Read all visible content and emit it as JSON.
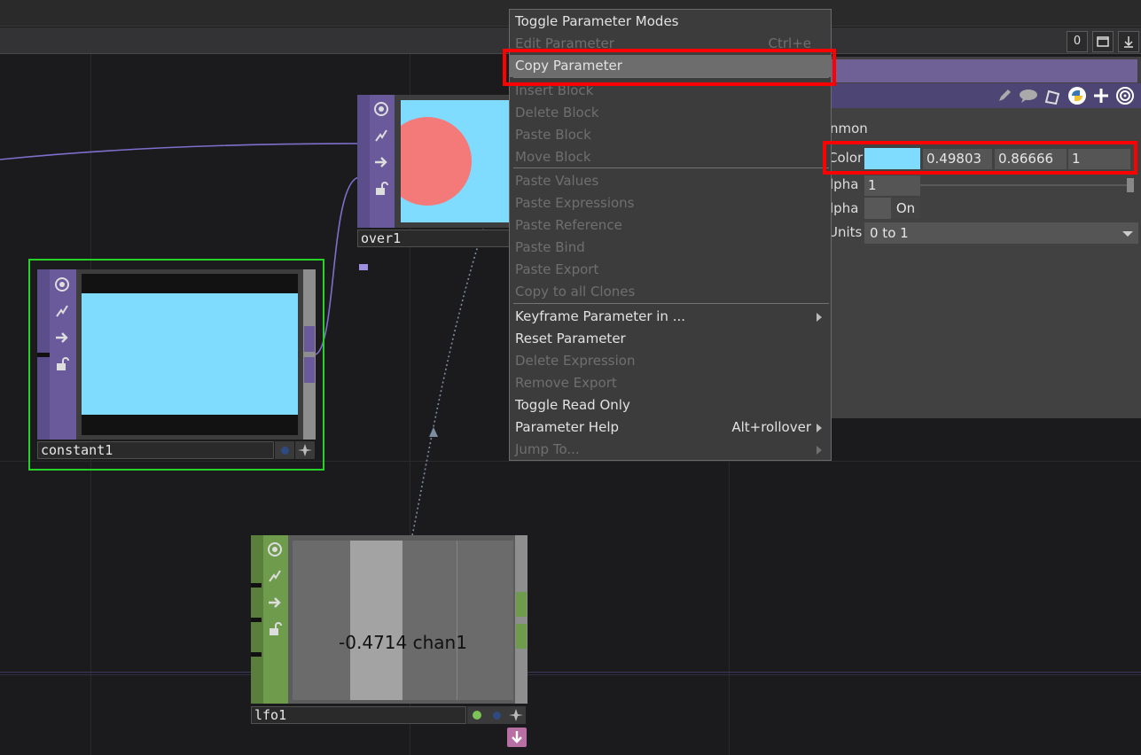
{
  "topbar": {
    "counter": "0"
  },
  "nodes": {
    "over1": {
      "name": "over1"
    },
    "constant1": {
      "name": "constant1"
    },
    "lfo1": {
      "name": "lfo1",
      "readout": "-0.4714 chan1"
    }
  },
  "colors": {
    "top_family": "#6a5a9c",
    "chop_family": "#6e9b4c",
    "selected_outline": "#28d128",
    "swatch": "#7fdcff",
    "circle": "#f47a7a",
    "menu_highlight": "#6d6d6d",
    "annotation_red": "#ff0000"
  },
  "context_menu": {
    "items": [
      {
        "label": "Toggle Parameter Modes",
        "enabled": true
      },
      {
        "label": "Edit Parameter",
        "shortcut": "Ctrl+e",
        "enabled": false
      },
      {
        "label": "Copy Parameter",
        "enabled": true,
        "highlighted": true
      },
      {
        "label": "Insert Block",
        "enabled": false
      },
      {
        "label": "Delete Block",
        "enabled": false
      },
      {
        "label": "Paste Block",
        "enabled": false
      },
      {
        "label": "Move Block",
        "enabled": false
      },
      {
        "label": "Paste Values",
        "enabled": false
      },
      {
        "label": "Paste Expressions",
        "enabled": false
      },
      {
        "label": "Paste Reference",
        "enabled": false
      },
      {
        "label": "Paste Bind",
        "enabled": false
      },
      {
        "label": "Paste Export",
        "enabled": false
      },
      {
        "label": "Copy to all Clones",
        "enabled": false
      },
      {
        "label": "Keyframe Parameter in ...",
        "enabled": true,
        "submenu": true
      },
      {
        "label": "Reset Parameter",
        "enabled": true
      },
      {
        "label": "Delete Expression",
        "enabled": false
      },
      {
        "label": "Remove Export",
        "enabled": false
      },
      {
        "label": "Toggle Read Only",
        "enabled": true
      },
      {
        "label": "Parameter Help",
        "shortcut": "Alt+rollover",
        "enabled": true,
        "submenu": true
      },
      {
        "label": "Jump To...",
        "enabled": false,
        "submenu": true
      }
    ]
  },
  "params": {
    "section": "nmon",
    "color": {
      "label": "Color",
      "r": "0.49803",
      "g": "0.86666",
      "b": "1"
    },
    "alpha": {
      "label": "lpha",
      "value": "1"
    },
    "premult": {
      "label": "lpha",
      "value": "On"
    },
    "units": {
      "label": "Units",
      "value": "0 to 1"
    }
  }
}
